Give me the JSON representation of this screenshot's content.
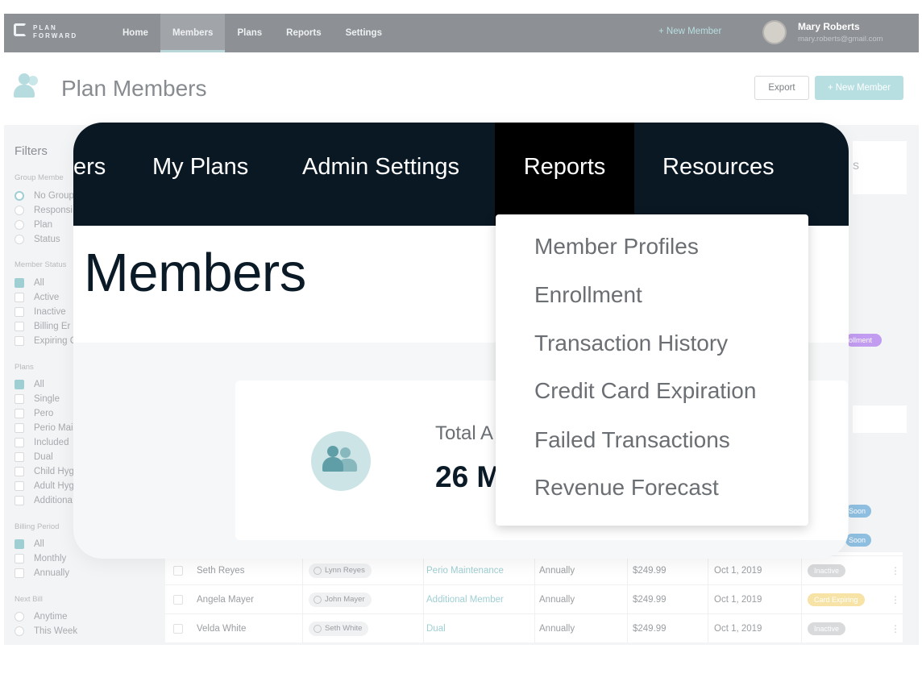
{
  "app": {
    "logo_line1": "PLAN",
    "logo_line2": "FORWARD",
    "nav": [
      "Home",
      "Members",
      "Plans",
      "Reports",
      "Settings"
    ],
    "active_nav": "Members",
    "nav_new_member": "+  New Member",
    "user": {
      "name": "Mary Roberts",
      "email": "mary.roberts@gmail.com"
    }
  },
  "page_header": {
    "title": "Plan Members",
    "export_label": "Export",
    "new_member_label": "+  New Member"
  },
  "filters": {
    "title": "Filters",
    "groups": [
      {
        "label": "Group Membe",
        "options": [
          {
            "label": "No Group",
            "checked": true,
            "type": "radio"
          },
          {
            "label": "Responsi",
            "checked": false,
            "type": "radio"
          },
          {
            "label": "Plan",
            "checked": false,
            "type": "radio"
          },
          {
            "label": "Status",
            "checked": false,
            "type": "radio"
          }
        ]
      },
      {
        "label": "Member Status",
        "options": [
          {
            "label": "All",
            "checked": true,
            "type": "checkbox"
          },
          {
            "label": "Active",
            "checked": false,
            "type": "checkbox"
          },
          {
            "label": "Inactive",
            "checked": false,
            "type": "checkbox"
          },
          {
            "label": "Billing Er",
            "checked": false,
            "type": "checkbox"
          },
          {
            "label": "Expiring C",
            "checked": false,
            "type": "checkbox"
          }
        ]
      },
      {
        "label": "Plans",
        "options": [
          {
            "label": "All",
            "checked": true,
            "type": "checkbox"
          },
          {
            "label": "Single",
            "checked": false,
            "type": "checkbox"
          },
          {
            "label": "Pero",
            "checked": false,
            "type": "checkbox"
          },
          {
            "label": "Perio Mai",
            "checked": false,
            "type": "checkbox"
          },
          {
            "label": "Included",
            "checked": false,
            "type": "checkbox"
          },
          {
            "label": "Dual",
            "checked": false,
            "type": "checkbox"
          },
          {
            "label": "Child Hyg",
            "checked": false,
            "type": "checkbox"
          },
          {
            "label": "Adult Hyg",
            "checked": false,
            "type": "checkbox"
          },
          {
            "label": "Additiona",
            "checked": false,
            "type": "checkbox"
          }
        ]
      },
      {
        "label": "Billing Period",
        "options": [
          {
            "label": "All",
            "checked": true,
            "type": "checkbox"
          },
          {
            "label": "Monthly",
            "checked": false,
            "type": "checkbox"
          },
          {
            "label": "Annually",
            "checked": false,
            "type": "checkbox"
          }
        ]
      },
      {
        "label": "Next Bill",
        "options": [
          {
            "label": "Anytime",
            "checked": false,
            "type": "radio"
          },
          {
            "label": "This Week",
            "checked": false,
            "type": "radio"
          }
        ]
      }
    ]
  },
  "table": {
    "rows": [
      {
        "name": "Seth Reyes",
        "responsible": "Lynn Reyes",
        "plan": "Perio Maintenance",
        "period": "Annually",
        "price": "$249.99",
        "date": "Oct 1, 2019",
        "status": "Inactive",
        "status_color": "#d9dadc"
      },
      {
        "name": "Angela Mayer",
        "responsible": "John Mayer",
        "plan": "Additional Member",
        "period": "Annually",
        "price": "$249.99",
        "date": "Oct 1, 2019",
        "status": "Card Expiring",
        "status_color": "#f7e3a6"
      },
      {
        "name": "Velda White",
        "responsible": "Seth White",
        "plan": "Dual",
        "period": "Annually",
        "price": "$249.99",
        "date": "Oct 1, 2019",
        "status": "Inactive",
        "status_color": "#d9dadc"
      }
    ],
    "peek_pills": [
      "ollment",
      "Soon",
      "Soon"
    ],
    "peek_card_text": "s"
  },
  "overlay": {
    "tabs": [
      "ers",
      "My Plans",
      "Admin Settings",
      "Reports",
      "Resources"
    ],
    "active_tab": "Reports",
    "title": "Members",
    "stat_label": "Total A",
    "stat_value": "26 M",
    "dropdown": [
      "Member Profiles",
      "Enrollment",
      "Transaction History",
      "Credit Card Expiration",
      "Failed Transactions",
      "Revenue Forecast"
    ]
  },
  "colors": {
    "accent": "#9fcfd3",
    "nav_dark": "#0a1824",
    "enrollment_pill": "#c29cf0",
    "soon_pill": "#8fbfe0"
  }
}
